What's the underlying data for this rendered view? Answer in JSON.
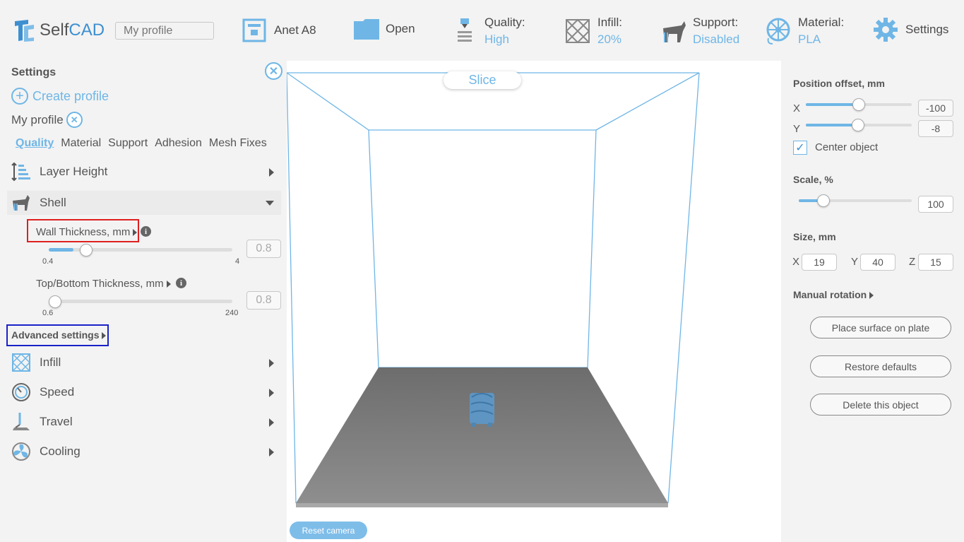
{
  "topbar": {
    "logo_self": "Self",
    "logo_cad": "CAD",
    "profile_placeholder": "My profile",
    "printer": "Anet A8",
    "open": "Open",
    "quality_label": "Quality:",
    "quality_value": "High",
    "infill_label": "Infill:",
    "infill_value": "20%",
    "support_label": "Support:",
    "support_value": "Disabled",
    "material_label": "Material:",
    "material_value": "PLA",
    "settings": "Settings"
  },
  "left": {
    "title": "Settings",
    "create_profile": "Create profile",
    "profile_name": "My profile",
    "tabs": [
      "Quality",
      "Material",
      "Support",
      "Adhesion",
      "Mesh Fixes"
    ],
    "layer_height": "Layer Height",
    "shell": "Shell",
    "wall_thickness": {
      "label": "Wall Thickness, mm",
      "min": "0.4",
      "max": "4",
      "value": "0.8",
      "fraction": 0.1
    },
    "topbottom": {
      "label": "Top/Bottom Thickness, mm",
      "min": "0.6",
      "max": "240",
      "value": "0.8",
      "fraction": 0.0
    },
    "advanced": "Advanced settings",
    "infill": "Infill",
    "speed": "Speed",
    "travel": "Travel",
    "cooling": "Cooling"
  },
  "viewport": {
    "slice": "Slice",
    "reset_camera": "Reset camera"
  },
  "right": {
    "position_title": "Position offset, mm",
    "x_label": "X",
    "y_label": "Y",
    "x_value": "-100",
    "y_value": "-8",
    "center_object": "Center object",
    "scale_title": "Scale, %",
    "scale_value": "100",
    "size_title": "Size, mm",
    "size_x": "19",
    "size_y": "40",
    "size_z": "15",
    "z_label": "Z",
    "manual_rotation": "Manual rotation",
    "place_surface": "Place surface on plate",
    "restore_defaults": "Restore defaults",
    "delete_object": "Delete this object"
  },
  "colors": {
    "accent": "#6fb6e6",
    "brand": "#3d8fd0",
    "highlight_red": "#e02020",
    "highlight_blue": "#1a22c8"
  }
}
